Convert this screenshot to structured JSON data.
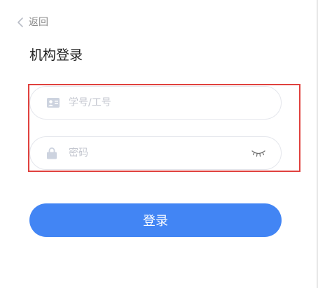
{
  "header": {
    "back_label": "返回",
    "back_icon": "chevron-left-icon"
  },
  "page": {
    "title": "机构登录"
  },
  "form": {
    "account": {
      "placeholder": "学号/工号",
      "value": "",
      "icon": "id-card-icon"
    },
    "password": {
      "placeholder": "密码",
      "value": "",
      "icon": "lock-icon",
      "toggle_icon": "eye-closed-icon"
    },
    "submit_label": "登录"
  },
  "colors": {
    "accent": "#4285f4",
    "highlight_border": "#e0413e",
    "placeholder": "#c3c6cf",
    "icon": "#cdd3df"
  }
}
